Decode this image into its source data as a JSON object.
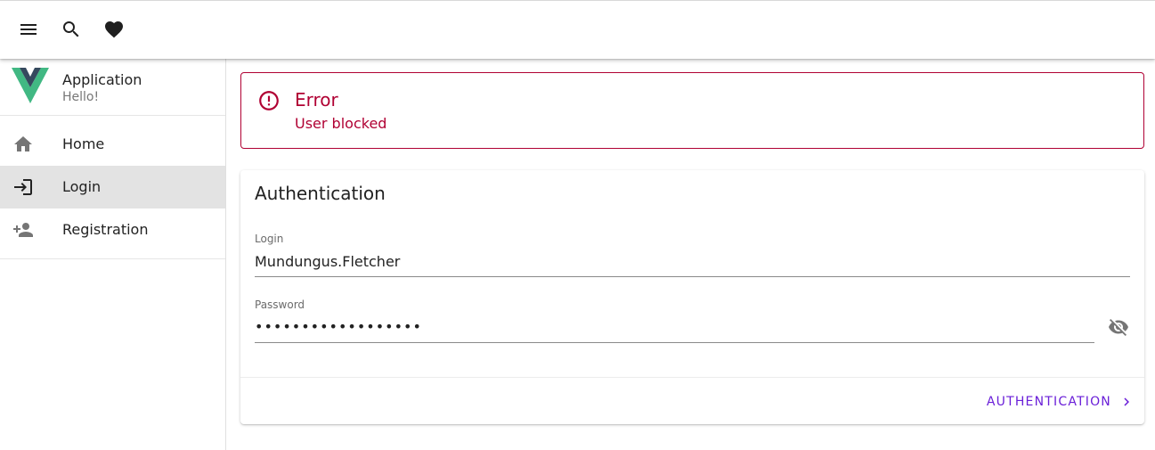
{
  "colors": {
    "error": "#b00033",
    "accent": "#6a1fd8",
    "logo_green": "#41b883",
    "logo_dark": "#35495e",
    "active_nav_bg": "#e3e3e3"
  },
  "toolbar": {
    "icons": [
      "menu-icon",
      "search-icon",
      "heart-icon"
    ]
  },
  "brand": {
    "title": "Application",
    "subtitle": "Hello!",
    "logo_icon": "vue-logo-icon"
  },
  "nav": {
    "items": [
      {
        "label": "Home",
        "icon": "home-icon",
        "active": false
      },
      {
        "label": "Login",
        "icon": "login-icon",
        "active": true
      },
      {
        "label": "Registration",
        "icon": "person-add-icon",
        "active": false
      }
    ]
  },
  "alert": {
    "title": "Error",
    "message": "User blocked",
    "icon": "error-circle-icon"
  },
  "card": {
    "title": "Authentication",
    "login_label": "Login",
    "login_value": "Mundungus.Fletcher",
    "password_label": "Password",
    "password_value": "••••••••••••••••••",
    "visibility_icon": "eye-off-icon",
    "submit_label": "AUTHENTICATION",
    "submit_icon": "chevron-right-icon"
  }
}
